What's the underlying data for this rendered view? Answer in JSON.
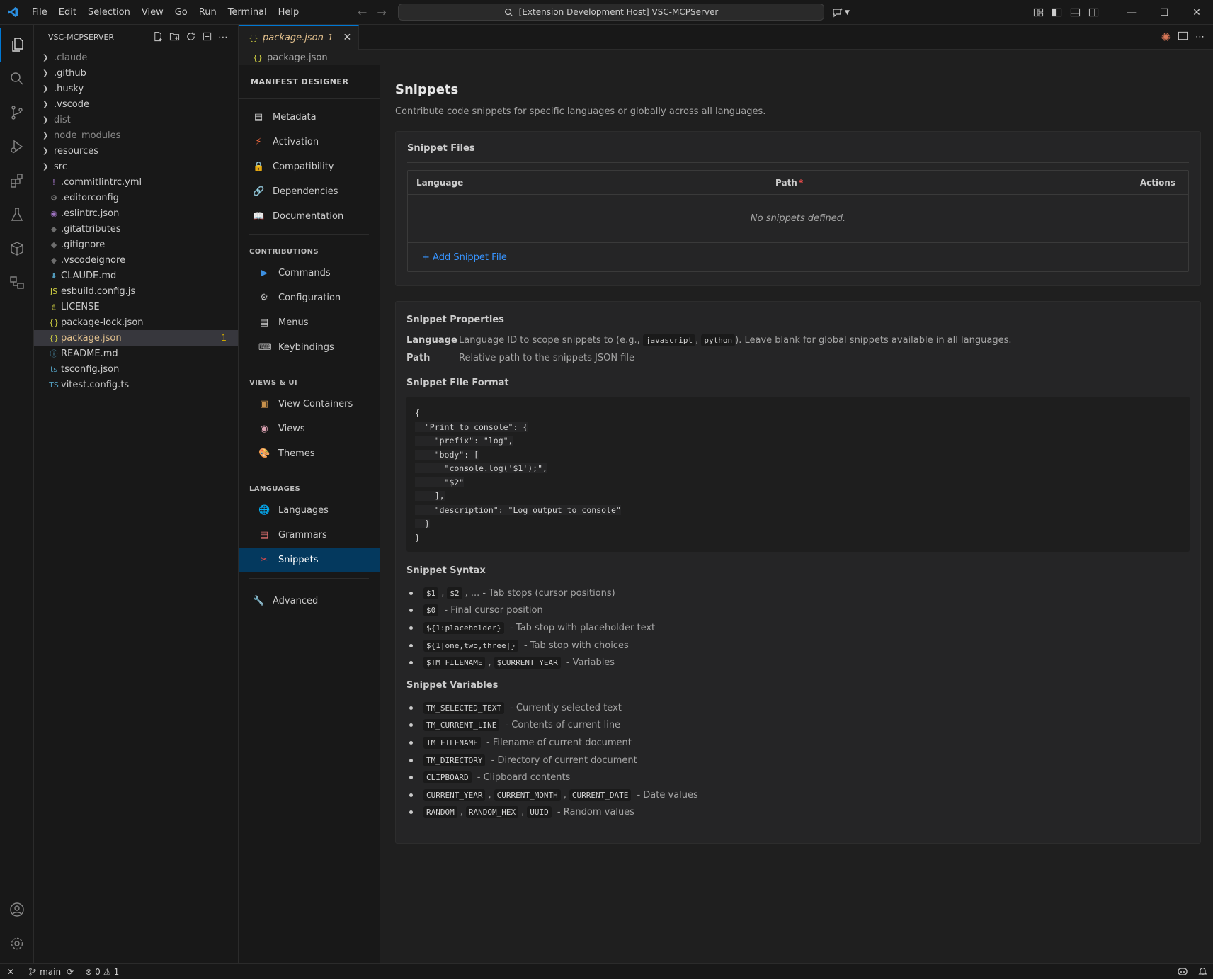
{
  "titlebar": {
    "menus": [
      "File",
      "Edit",
      "Selection",
      "View",
      "Go",
      "Run",
      "Terminal",
      "Help"
    ],
    "command_center": "[Extension Development Host] VSC-MCPServer"
  },
  "explorer": {
    "title": "VSC-MCPSERVER",
    "items": [
      {
        "label": ".claude",
        "folder": true,
        "dim": true
      },
      {
        "label": ".github",
        "folder": true
      },
      {
        "label": ".husky",
        "folder": true
      },
      {
        "label": ".vscode",
        "folder": true
      },
      {
        "label": "dist",
        "folder": true,
        "dim": true
      },
      {
        "label": "node_modules",
        "folder": true,
        "dim": true
      },
      {
        "label": "resources",
        "folder": true
      },
      {
        "label": "src",
        "folder": true
      },
      {
        "label": ".commitlintrc.yml",
        "icon": "!",
        "color": "#a074c4"
      },
      {
        "label": ".editorconfig",
        "icon": "⚙",
        "color": "#8b8b8b"
      },
      {
        "label": ".eslintrc.json",
        "icon": "◉",
        "color": "#a074c4"
      },
      {
        "label": ".gitattributes",
        "icon": "◆",
        "color": "#6d6d6d"
      },
      {
        "label": ".gitignore",
        "icon": "◆",
        "color": "#6d6d6d"
      },
      {
        "label": ".vscodeignore",
        "icon": "◆",
        "color": "#6d6d6d"
      },
      {
        "label": "CLAUDE.md",
        "icon": "⬇",
        "color": "#519aba"
      },
      {
        "label": "esbuild.config.js",
        "icon": "JS",
        "color": "#cbcb41"
      },
      {
        "label": "LICENSE",
        "icon": "♗",
        "color": "#cbcb41"
      },
      {
        "label": "package-lock.json",
        "icon": "{}",
        "color": "#cbcb41"
      },
      {
        "label": "package.json",
        "icon": "{}",
        "color": "#cbcb41",
        "selected": true,
        "badge": "1"
      },
      {
        "label": "README.md",
        "icon": "ⓘ",
        "color": "#519aba"
      },
      {
        "label": "tsconfig.json",
        "icon": "ts",
        "color": "#519aba"
      },
      {
        "label": "vitest.config.ts",
        "icon": "TS",
        "color": "#519aba"
      }
    ]
  },
  "editor": {
    "tab_label": "package.json",
    "tab_badge": "1",
    "breadcrumb": "package.json"
  },
  "manifest_nav": {
    "title": "MANIFEST DESIGNER",
    "top_items": [
      {
        "label": "Metadata",
        "icon": "▤",
        "color": "#d0d0d0"
      },
      {
        "label": "Activation",
        "icon": "⚡",
        "color": "#f0683e"
      },
      {
        "label": "Compatibility",
        "icon": "🔒",
        "color": "#e8b23a"
      },
      {
        "label": "Dependencies",
        "icon": "🔗",
        "color": "#c0c0c0"
      },
      {
        "label": "Documentation",
        "icon": "📖",
        "color": "#cccccc"
      }
    ],
    "groups": [
      {
        "title": "CONTRIBUTIONS",
        "items": [
          {
            "label": "Commands",
            "icon": "▶",
            "color": "#3c8fe0"
          },
          {
            "label": "Configuration",
            "icon": "⚙",
            "color": "#c0c0c0"
          },
          {
            "label": "Menus",
            "icon": "▤",
            "color": "#d0d0d0"
          },
          {
            "label": "Keybindings",
            "icon": "⌨",
            "color": "#b0b0b0"
          }
        ]
      },
      {
        "title": "VIEWS & UI",
        "items": [
          {
            "label": "View Containers",
            "icon": "▣",
            "color": "#c8914b"
          },
          {
            "label": "Views",
            "icon": "◉",
            "color": "#d9a0b0"
          },
          {
            "label": "Themes",
            "icon": "🎨",
            "color": "#e07a7a"
          }
        ]
      },
      {
        "title": "LANGUAGES",
        "items": [
          {
            "label": "Languages",
            "icon": "🌐",
            "color": "#4aa3df"
          },
          {
            "label": "Grammars",
            "icon": "▤",
            "color": "#e07070"
          },
          {
            "label": "Snippets",
            "icon": "✂",
            "color": "#e04a4a",
            "active": true
          }
        ]
      }
    ],
    "advanced": {
      "label": "Advanced",
      "icon": "🔧",
      "color": "#cccccc"
    }
  },
  "content": {
    "title": "Snippets",
    "description": "Contribute code snippets for specific languages or globally across all languages.",
    "files_card": {
      "title": "Snippet Files",
      "col_language": "Language",
      "col_path": "Path",
      "col_path_required": "*",
      "col_actions": "Actions",
      "empty": "No snippets defined.",
      "add_label": "+ Add Snippet File"
    },
    "properties": {
      "title": "Snippet Properties",
      "language_key": "Language",
      "language_desc_before": "Language ID to scope snippets to (e.g.,",
      "language_code1": "javascript",
      "language_sep": ",",
      "language_code2": "python",
      "language_desc_after": "). Leave blank for global snippets available in all languages.",
      "path_key": "Path",
      "path_desc": "Relative path to the snippets JSON file"
    },
    "format": {
      "title": "Snippet File Format",
      "lines": [
        "{",
        "  \"Print to console\": {",
        "    \"prefix\": \"log\",",
        "    \"body\": [",
        "      \"console.log('$1');\",",
        "      \"$2\"",
        "    ],",
        "    \"description\": \"Log output to console\"",
        "  }",
        "}"
      ]
    },
    "syntax": {
      "title": "Snippet Syntax",
      "items": [
        {
          "codes": [
            "$1",
            "$2"
          ],
          "desc": ", ... - Tab stops (cursor positions)"
        },
        {
          "codes": [
            "$0"
          ],
          "desc": " - Final cursor position"
        },
        {
          "codes": [
            "${1:placeholder}"
          ],
          "desc": " - Tab stop with placeholder text"
        },
        {
          "codes": [
            "${1|one,two,three|}"
          ],
          "desc": " - Tab stop with choices"
        },
        {
          "codes": [
            "$TM_FILENAME",
            "$CURRENT_YEAR"
          ],
          "desc": " - Variables"
        }
      ]
    },
    "variables": {
      "title": "Snippet Variables",
      "items": [
        {
          "codes": [
            "TM_SELECTED_TEXT"
          ],
          "desc": " - Currently selected text"
        },
        {
          "codes": [
            "TM_CURRENT_LINE"
          ],
          "desc": " - Contents of current line"
        },
        {
          "codes": [
            "TM_FILENAME"
          ],
          "desc": " - Filename of current document"
        },
        {
          "codes": [
            "TM_DIRECTORY"
          ],
          "desc": " - Directory of current document"
        },
        {
          "codes": [
            "CLIPBOARD"
          ],
          "desc": " - Clipboard contents"
        },
        {
          "codes": [
            "CURRENT_YEAR",
            "CURRENT_MONTH",
            "CURRENT_DATE"
          ],
          "desc": " - Date values"
        },
        {
          "codes": [
            "RANDOM",
            "RANDOM_HEX",
            "UUID"
          ],
          "desc": " - Random values"
        }
      ]
    }
  },
  "statusbar": {
    "branch": "main",
    "errors": "0",
    "warnings": "1"
  },
  "colors": {
    "accent": "#0078d4",
    "link": "#3794ff",
    "modified": "#e2c08d",
    "active_nav": "#04395e"
  }
}
